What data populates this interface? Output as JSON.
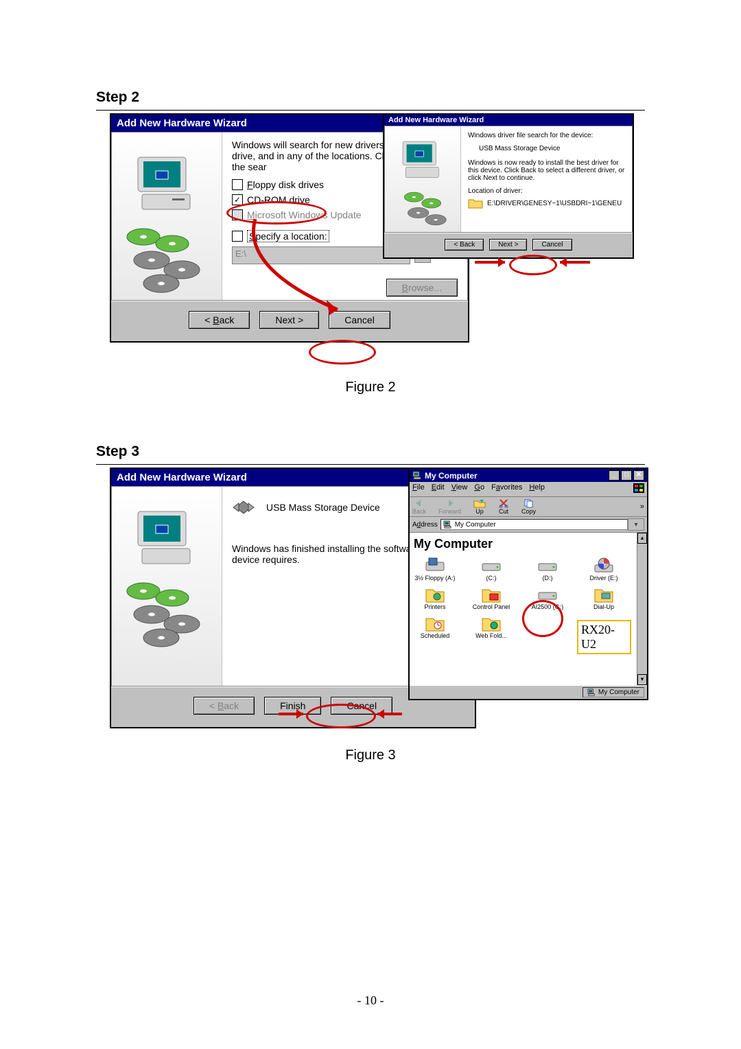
{
  "page_number_label": "- 10 -",
  "step2": {
    "heading": "Step 2",
    "caption": "Figure 2",
    "wizard_left": {
      "title": "Add New Hardware Wizard",
      "intro": "Windows will search for new drivers on your hard drive, and in any of the locations. Click Next to start the sear",
      "opt_floppy": "Floppy disk drives",
      "opt_cdrom": "CD-ROM drive",
      "opt_update": "Microsoft Windows Update",
      "opt_specify": "Specify a location:",
      "path_value": "E:\\",
      "browse": "Browse...",
      "back": "< Back",
      "next": "Next >",
      "cancel": "Cancel"
    },
    "wizard_right": {
      "title": "Add New Hardware Wizard",
      "line1": "Windows driver file search for the device:",
      "device": "USB Mass Storage Device",
      "line2": "Windows is now ready to install the best driver for this device. Click Back to select a different driver, or click Next to continue.",
      "loc_label": "Location of driver:",
      "loc_value": "E:\\DRIVER\\GENESY~1\\USBDRI~1\\GENEU",
      "back": "< Back",
      "next": "Next >",
      "cancel": "Cancel"
    }
  },
  "step3": {
    "heading": "Step 3",
    "caption": "Figure 3",
    "wizard": {
      "title": "Add New Hardware Wizard",
      "device": "USB Mass Storage Device",
      "body": "Windows has finished installing the software hardware device requires.",
      "back": "< Back",
      "finish": "Finish",
      "cancel": "Cancel"
    },
    "mycomputer": {
      "title": "My Computer",
      "menu": {
        "file": "File",
        "edit": "Edit",
        "view": "View",
        "go": "Go",
        "fav": "Favorites",
        "help": "Help"
      },
      "toolbar": {
        "back": "Back",
        "forward": "Forward",
        "up": "Up",
        "cut": "Cut",
        "copy": "Copy"
      },
      "address_label": "Address",
      "address_value": "My Computer",
      "heading": "My Computer",
      "drives": {
        "floppy": "3½ Floppy (A:)",
        "c": "(C:)",
        "d": "(D:)",
        "e": "Driver (E:)",
        "printers": "Printers",
        "ctrl": "Control Panel",
        "g": "AI2500 (G:)",
        "dial": "Dial-Up",
        "sched": "Scheduled",
        "web": "Web Fold..."
      },
      "status": "My Computer",
      "callout": "RX20-U2"
    }
  }
}
